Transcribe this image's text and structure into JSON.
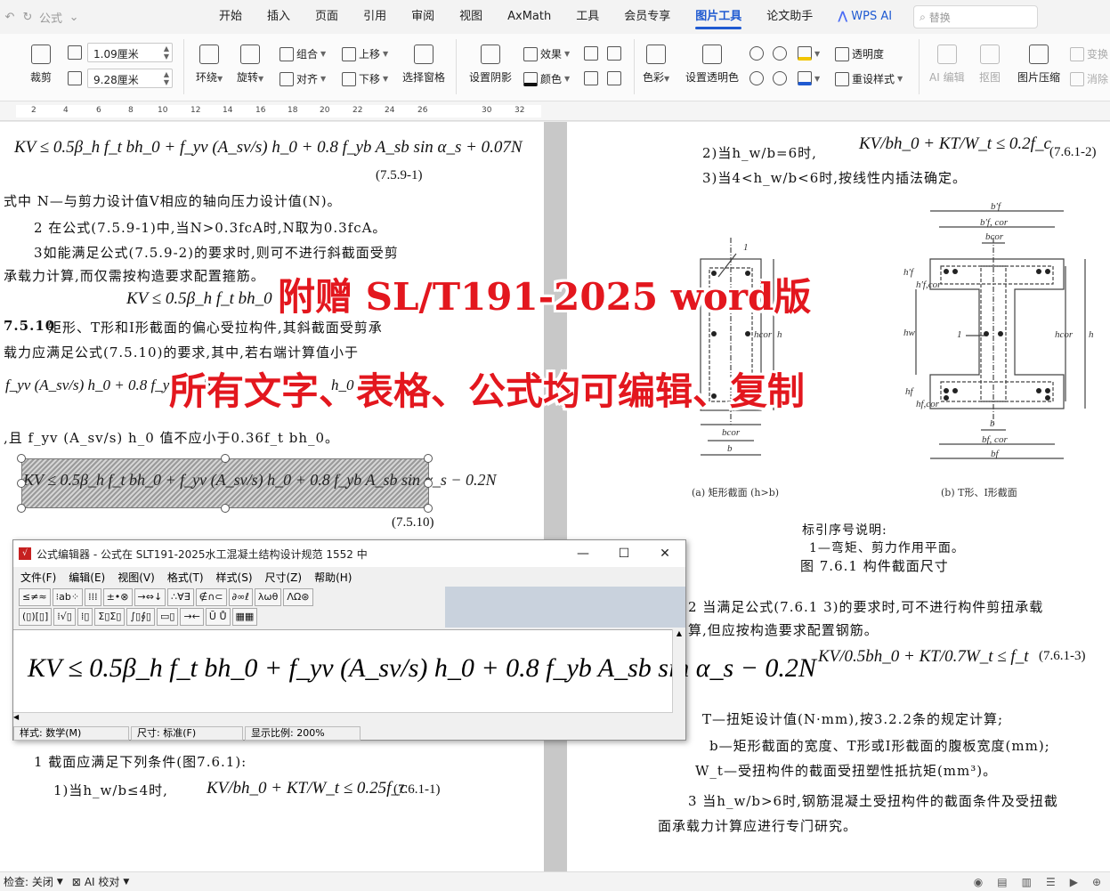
{
  "menubar": {
    "quick_access": "公式",
    "tabs": [
      "开始",
      "插入",
      "页面",
      "引用",
      "审阅",
      "视图",
      "AxMath",
      "工具",
      "会员专享",
      "图片工具",
      "论文助手",
      "WPS AI"
    ],
    "active_tab": "图片工具",
    "search_placeholder": "替换"
  },
  "ribbon": {
    "crop": "裁剪",
    "width": "1.09厘米",
    "height": "9.28厘米",
    "wrap": "环绕",
    "rotate": "旋转",
    "group": "组合",
    "align": "对齐",
    "bring_forward": "上移",
    "send_backward": "下移",
    "selection_pane": "选择窗格",
    "shadow": "设置阴影",
    "effect": "效果",
    "color": "颜色",
    "color_mode": "色彩",
    "set_transparent": "设置透明色",
    "transparency": "透明度",
    "reset_style": "重设样式",
    "ai_edit": "AI 编辑",
    "cutout": "抠图",
    "compress": "图片压缩",
    "change": "变换",
    "erase": "消除"
  },
  "ruler_numbers": [
    "2",
    "4",
    "6",
    "8",
    "10",
    "12",
    "14",
    "16",
    "18",
    "20",
    "22",
    "24",
    "26",
    "30",
    "32"
  ],
  "left_page": {
    "eq1": "KV ≤ 0.5β_h f_t bh_0 + f_yv (A_sv/s) h_0 + 0.8 f_yb A_sb sin α_s + 0.07N",
    "eq1_num": "(7.5.9-1)",
    "where_line": "式中   N—与剪力设计值V相应的轴向压力设计值(N)。",
    "item2": "2 在公式(7.5.9-1)中,当N>0.3fcA时,N取为0.3fcA。",
    "item3a": "3如能满足公式(7.5.9-2)的要求时,则可不进行斜截面受剪",
    "item3b": "承载力计算,而仅需按构造要求配置箍筋。",
    "eq2": "KV ≤ 0.5β_h f_t bh_0 + 0",
    "clause_no": "7.5.10",
    "clause_a": "矩形、T形和I形截面的偏心受拉构件,其斜截面受剪承",
    "clause_b": "载力应满足公式(7.5.10)的要求,其中,若右端计算值小于",
    "eq3": "f_yv (A_sv/s) h_0 + 0.8 f_yb A_sb sin",
    "eq3_tail": "h_0 + 0.",
    "cond": ",且 f_yv (A_sv/s) h_0 值不应小于0.36f_t bh_0。",
    "eq4": "KV ≤ 0.5β_h f_t bh_0 + f_yv (A_sv/s) h_0 + 0.8 f_yb A_sb sin α_s − 0.2N",
    "eq4_num": "(7.5.10)",
    "sec1": "1 截面应满足下列条件(图7.6.1):",
    "sub1": "1)当h_w/b≤4时,",
    "eq5": "KV/bh_0 + KT/W_t ≤ 0.25f_c",
    "eq5_num": "(7.6.1-1)"
  },
  "right_page": {
    "sub2": "2)当h_w/b=6时,",
    "eq6": "KV/bh_0 + KT/W_t ≤ 0.2f_c",
    "eq6_num": "(7.6.1-2)",
    "sub3": "3)当4<h_w/b<6时,按线性内插法确定。",
    "diagram_labels": {
      "b_f_prime": "b′f",
      "b_f_cor_prime": "b′f, cor",
      "b_cor": "bcor",
      "b": "b",
      "b_f_cor": "bf, cor",
      "b_f": "bf",
      "h": "h",
      "h_cor": "hcor",
      "h_w": "hw",
      "h_f_prime": "h′f",
      "h_f_cor_prime": "h′f,cor",
      "h_f": "hf",
      "h_f_cor": "hf,cor",
      "callout": "1"
    },
    "caption_a": "(a) 矩形截面 (h>b)",
    "caption_b": "(b) T形、I形截面",
    "legend_title": "标引序号说明:",
    "legend_item": "1—弯矩、剪力作用平面。",
    "figure_title": "图 7.6.1  构件截面尺寸",
    "item2a": "2 当满足公式(7.6.1 3)的要求时,可不进行构件剪扭承载",
    "item2b": "算,但应按构造要求配置钢筋。",
    "eq7": "KV/0.5bh_0 + KT/0.7W_t ≤ f_t",
    "eq7_num": "(7.6.1-3)",
    "def_T": "T—扭矩设计值(N·mm),按3.2.2条的规定计算;",
    "def_b": "b—矩形截面的宽度、T形或I形截面的腹板宽度(mm);",
    "def_W": "W_t—受扭构件的截面受扭塑性抵抗矩(mm³)。",
    "item3a": "3 当h_w/b>6时,钢筋混凝土受扭构件的截面条件及受扭截",
    "item3b": "面承载力计算应进行专门研究。"
  },
  "banners": {
    "line1": "附赠  SL/T191-2025 word版",
    "line2": "所有文字、表格、公式均可编辑、复制"
  },
  "editor": {
    "title": "公式编辑器 - 公式在 SLT191-2025水工混凝土结构设计规范 1552 中",
    "menus": [
      "文件(F)",
      "编辑(E)",
      "视图(V)",
      "格式(T)",
      "样式(S)",
      "尺寸(Z)",
      "帮助(H)"
    ],
    "palette_row1": [
      "≤≠≈",
      "⁝ab⁘",
      "⁞⁞⁞",
      "±•⊗",
      "→⇔↓",
      "∴∀∃",
      "∉∩⊂",
      "∂∞ℓ",
      "λωθ",
      "ΛΩ⊛"
    ],
    "palette_row2": [
      "(▯)[▯]",
      "⁞√▯",
      "⁞▯",
      "Σ▯Σ▯",
      "∫▯∮▯",
      "▭▯",
      "→←",
      "Ū Ů",
      "▦▦"
    ],
    "formula": "KV ≤ 0.5β_h f_t bh_0 + f_yv (A_sv/s) h_0 + 0.8 f_yb A_sb sin α_s − 0.2N",
    "status_style": "样式: 数学(M)",
    "status_size": "尺寸: 标准(F)",
    "status_zoom": "显示比例: 200%"
  },
  "statusbar": {
    "check": "检查: 关闭",
    "ai_check": "AI 校对"
  }
}
